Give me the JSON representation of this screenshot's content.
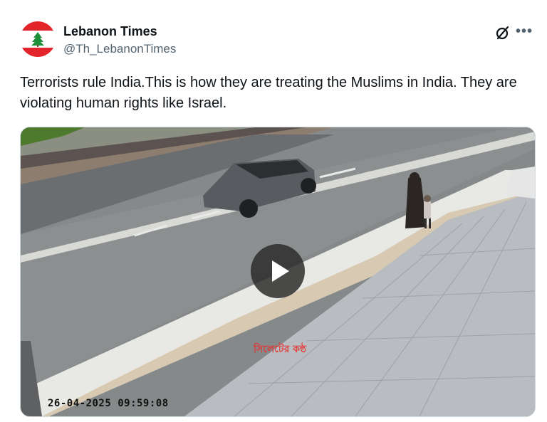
{
  "account": {
    "display_name": "Lebanon Times",
    "handle": "@Th_LebanonTimes",
    "avatar_icon": "lebanon-flag-icon"
  },
  "header_icons": [
    "grok-icon",
    "more-options-icon"
  ],
  "tweet": {
    "text": "Terrorists rule India.This is how they are treating the Muslims in India. They are violating human rights like Israel."
  },
  "video": {
    "timestamp": "26-04-2025 09:59:08",
    "watermark": "সিলেটের কন্ঠ",
    "play_icon": "play-icon"
  },
  "colors": {
    "text": "#0f1419",
    "secondary_text": "#536471",
    "flag_red": "#e3242b",
    "flag_green": "#1f8f3a"
  }
}
